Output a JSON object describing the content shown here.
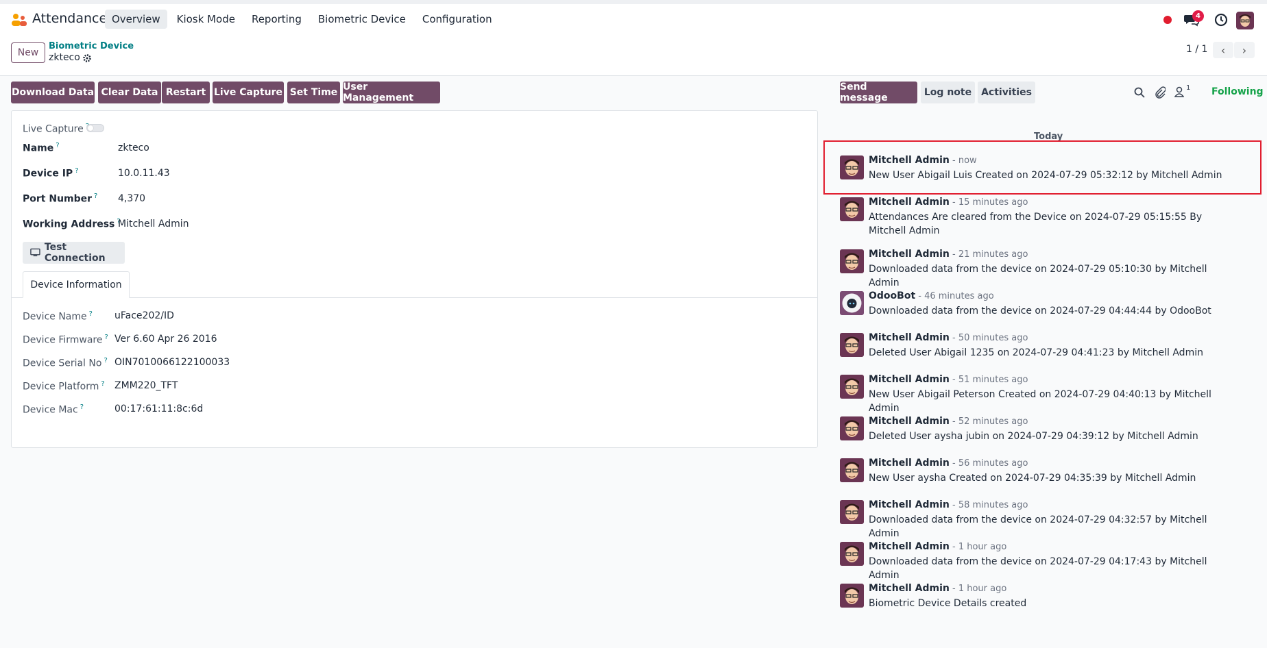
{
  "nav": {
    "app_name": "Attendances",
    "menu": [
      "Overview",
      "Kiosk Mode",
      "Reporting",
      "Biometric Device",
      "Configuration"
    ],
    "chat_count": "4"
  },
  "control": {
    "new_label": "New",
    "breadcrumb": "Biometric Device",
    "record": "zkteco",
    "pager": "1 / 1"
  },
  "actions": {
    "download": "Download Data",
    "clear": "Clear Data",
    "restart": "Restart",
    "live_capture": "Live Capture",
    "set_time": "Set Time",
    "user_mgmt": "User Management"
  },
  "form": {
    "live_capture_label": "Live Capture",
    "name_label": "Name",
    "name_value": "zkteco",
    "ip_label": "Device IP",
    "ip_value": "10.0.11.43",
    "port_label": "Port Number",
    "port_value": "4,370",
    "address_label": "Working Address",
    "address_value": "Mitchell Admin",
    "test_btn": "Test Connection",
    "tab": "Device Information",
    "fields": [
      {
        "label": "Device Name",
        "value": "uFace202/ID"
      },
      {
        "label": "Device Firmware",
        "value": "Ver 6.60 Apr 26 2016"
      },
      {
        "label": "Device Serial No",
        "value": "OIN7010066122100033"
      },
      {
        "label": "Device Platform",
        "value": "ZMM220_TFT"
      },
      {
        "label": "Device Mac",
        "value": "00:17:61:11:8c:6d"
      }
    ]
  },
  "chatter": {
    "send_message": "Send message",
    "log_note": "Log note",
    "activities": "Activities",
    "followers_count": "1",
    "following": "Following",
    "today": "Today",
    "messages": [
      {
        "author": "Mitchell Admin",
        "time": "now",
        "body": "New User Abigail Luis Created on 2024-07-29 05:32:12 by Mitchell Admin"
      },
      {
        "author": "Mitchell Admin",
        "time": "15 minutes ago",
        "body": "Attendances Are cleared from the Device on 2024-07-29 05:15:55 By Mitchell Admin"
      },
      {
        "author": "Mitchell Admin",
        "time": "21 minutes ago",
        "body": "Downloaded data from the device on 2024-07-29 05:10:30 by Mitchell Admin"
      },
      {
        "author": "OdooBot",
        "time": "46 minutes ago",
        "body": "Downloaded data from the device on 2024-07-29 04:44:44 by OdooBot"
      },
      {
        "author": "Mitchell Admin",
        "time": "50 minutes ago",
        "body": "Deleted User Abigail 1235 on 2024-07-29 04:41:23 by Mitchell Admin"
      },
      {
        "author": "Mitchell Admin",
        "time": "51 minutes ago",
        "body": "New User Abigail Peterson Created on 2024-07-29 04:40:13 by Mitchell Admin"
      },
      {
        "author": "Mitchell Admin",
        "time": "52 minutes ago",
        "body": "Deleted User aysha jubin on 2024-07-29 04:39:12 by Mitchell Admin"
      },
      {
        "author": "Mitchell Admin",
        "time": "56 minutes ago",
        "body": "New User aysha Created on 2024-07-29 04:35:39 by Mitchell Admin"
      },
      {
        "author": "Mitchell Admin",
        "time": "58 minutes ago",
        "body": "Downloaded data from the device on 2024-07-29 04:32:57 by Mitchell Admin"
      },
      {
        "author": "Mitchell Admin",
        "time": "1 hour ago",
        "body": "Downloaded data from the device on 2024-07-29 04:17:43 by Mitchell Admin"
      },
      {
        "author": "Mitchell Admin",
        "time": "1 hour ago",
        "body": "Biometric Device Details created"
      }
    ]
  }
}
